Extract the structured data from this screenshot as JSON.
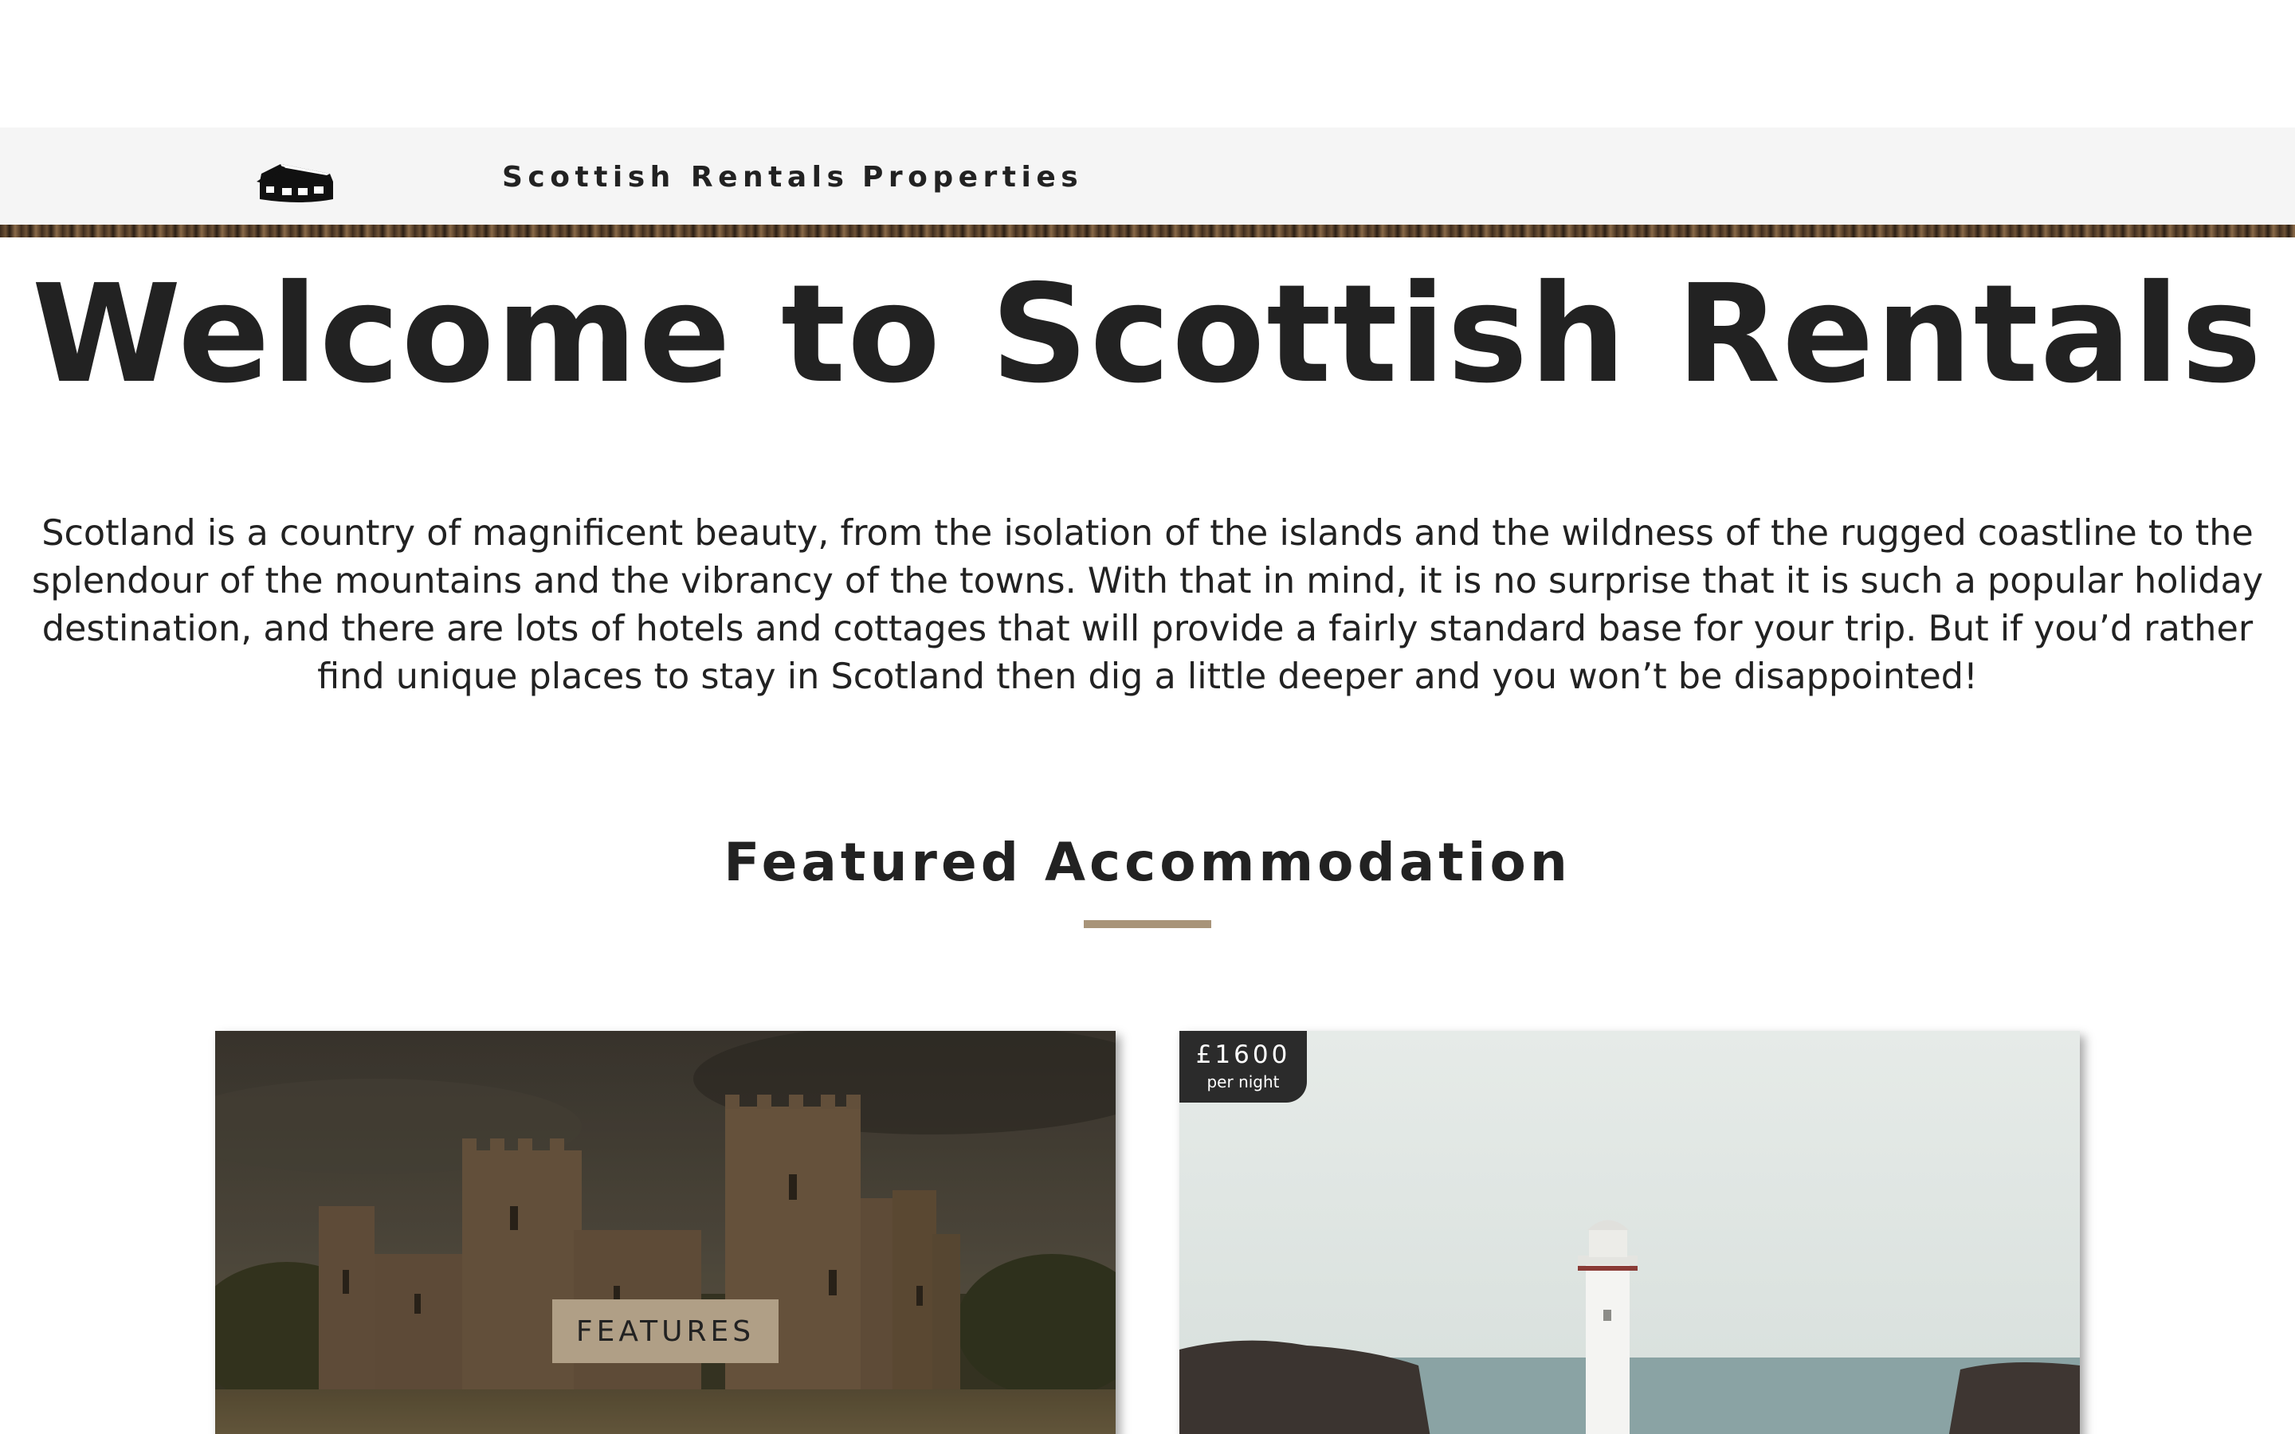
{
  "nav": {
    "logo_icon": "house-icon",
    "links": [
      {
        "label": "Scottish Rentals"
      },
      {
        "label": "Properties"
      }
    ]
  },
  "hero": {
    "title": "Welcome to Scottish Rentals",
    "intro": "Scotland is a country of magnificent beauty, from the isolation of the islands and the wildness of the rugged coastline to the splendour of the mountains and the vibrancy of the towns. With that in mind, it is no surprise that it is such a popular holiday destination, and there are lots of hotels and cottages that will provide a fairly standard base for your trip. But if you’d rather find unique places to stay in Scotland then dig a little deeper and you won’t be disappointed!"
  },
  "featured": {
    "title": "Featured Accommodation",
    "underline_color": "#a89479",
    "cards": [
      {
        "image": "castle-photo",
        "button_label": "FEATURES"
      },
      {
        "image": "lighthouse-photo",
        "price": "£1600",
        "price_unit": "per night"
      }
    ]
  },
  "colors": {
    "nav_background": "#f5f5f5",
    "text": "#222222",
    "accent": "#b09f86",
    "price_tag_background": "#2b2b2b"
  }
}
